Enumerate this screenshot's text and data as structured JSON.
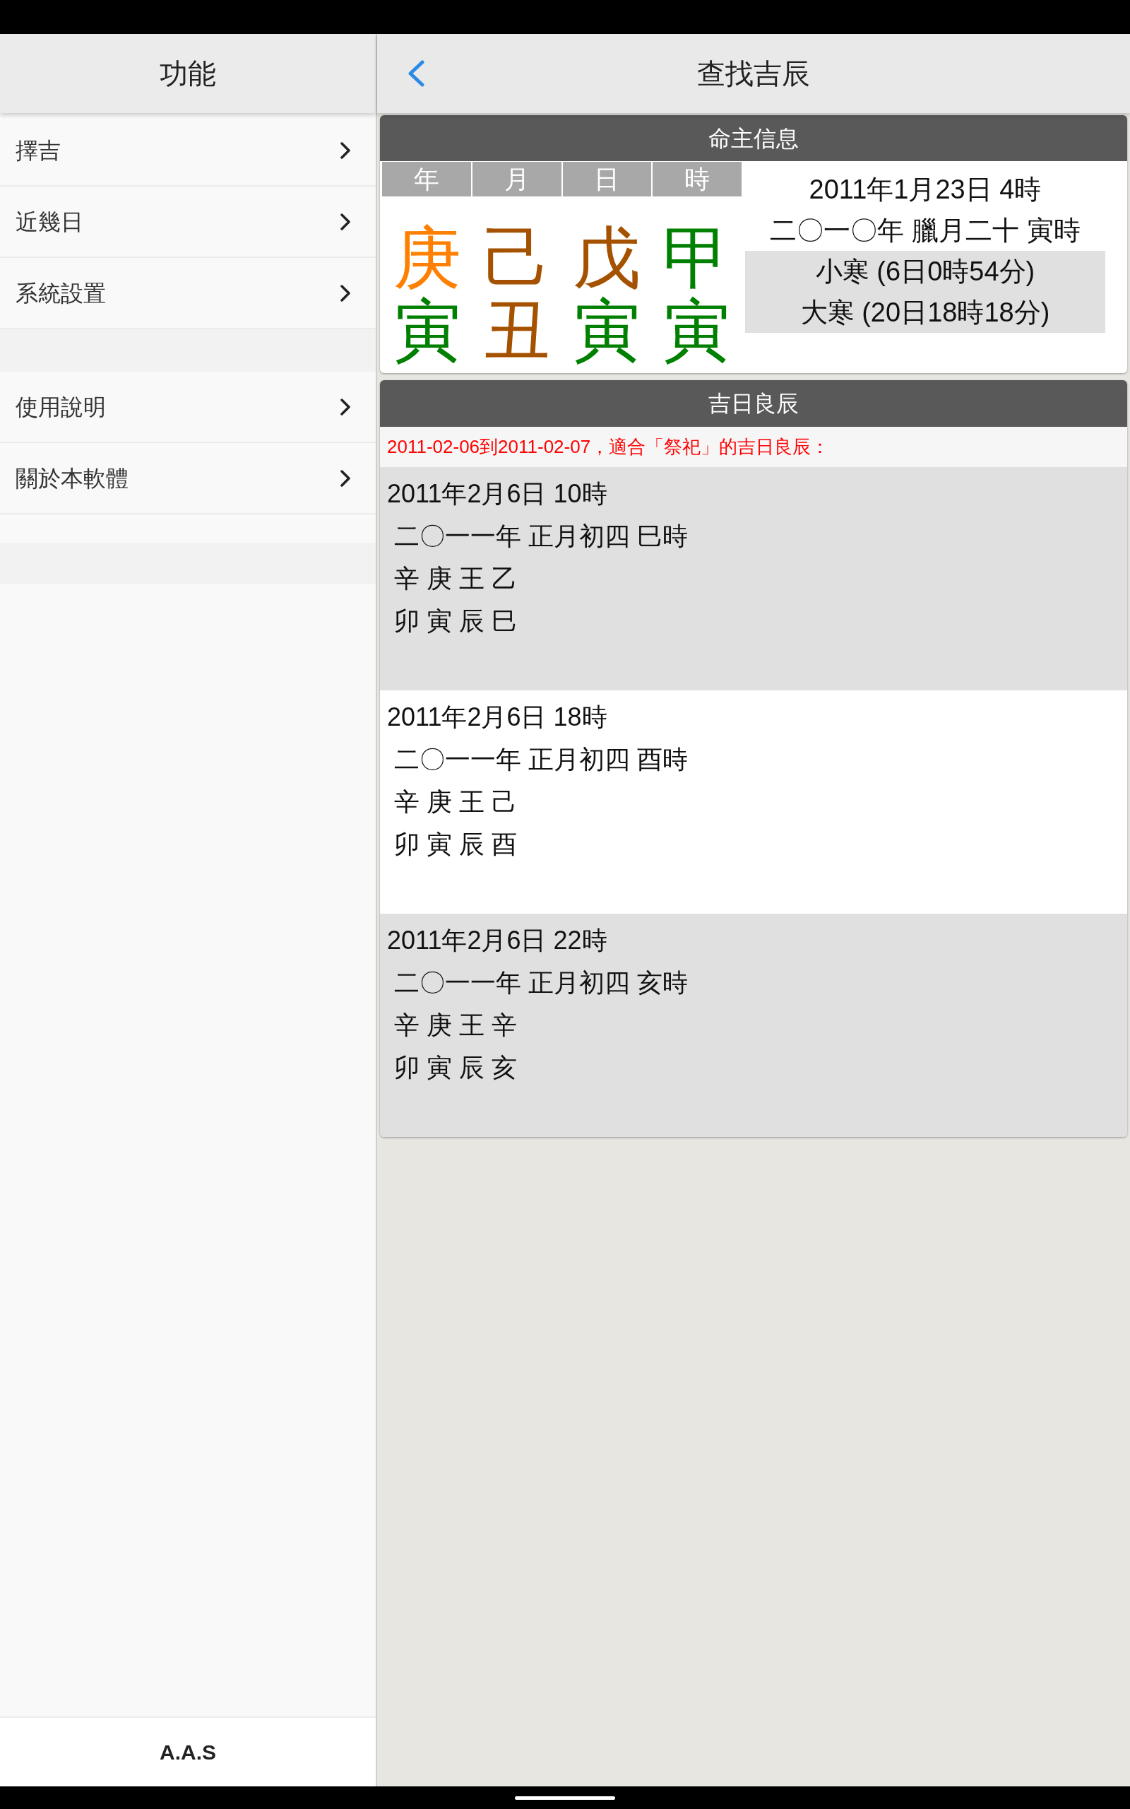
{
  "sidebar": {
    "title": "功能",
    "groups": [
      {
        "items": [
          {
            "label": "擇吉"
          },
          {
            "label": "近幾日"
          },
          {
            "label": "系統設置"
          }
        ]
      },
      {
        "items": [
          {
            "label": "使用說明"
          },
          {
            "label": "關於本軟體"
          }
        ]
      }
    ],
    "footer": "A.A.S"
  },
  "header": {
    "title": "查找吉辰"
  },
  "owner_info": {
    "title": "命主信息",
    "pillar_labels": [
      "年",
      "月",
      "日",
      "時"
    ],
    "stems": [
      {
        "char": "庚",
        "color": "#ff8000"
      },
      {
        "char": "己",
        "color": "#a45200"
      },
      {
        "char": "戊",
        "color": "#a45200"
      },
      {
        "char": "甲",
        "color": "#008000"
      }
    ],
    "branches": [
      {
        "char": "寅",
        "color": "#008000"
      },
      {
        "char": "丑",
        "color": "#a45200"
      },
      {
        "char": "寅",
        "color": "#008000"
      },
      {
        "char": "寅",
        "color": "#008000"
      }
    ],
    "solar_date": "2011年1月23日 4時",
    "lunar_date": "二〇一〇年 臘月二十 寅時",
    "solar_terms": [
      "小寒 (6日0時54分)",
      "大寒 (20日18時18分)"
    ]
  },
  "results": {
    "title": "吉日良辰",
    "summary": "2011-02-06到2011-02-07，適合「祭祀」的吉日良辰：",
    "entries": [
      {
        "solar_date": "2011年2月6日 10時",
        "lunar_date": "二〇一一年 正月初四 巳時",
        "stems": "辛 庚 王 乙",
        "branches": "卯 寅 辰 巳"
      },
      {
        "solar_date": "2011年2月6日 18時",
        "lunar_date": "二〇一一年 正月初四 酉時",
        "stems": "辛 庚 王 己",
        "branches": "卯 寅 辰 酉"
      },
      {
        "solar_date": "2011年2月6日 22時",
        "lunar_date": "二〇一一年 正月初四 亥時",
        "stems": "辛 庚 王 辛",
        "branches": "卯 寅 辰 亥"
      }
    ]
  }
}
